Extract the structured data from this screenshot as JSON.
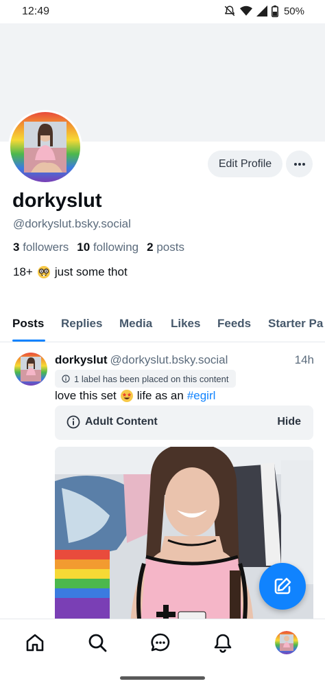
{
  "status_bar": {
    "time": "12:49",
    "battery": "50%",
    "icons": [
      "bell-muted-icon",
      "wifi-icon",
      "signal-icon",
      "battery-icon"
    ]
  },
  "profile": {
    "display_name": "dorkyslut",
    "handle": "@dorkyslut.bsky.social",
    "followers_count": "3",
    "followers_label": "followers",
    "following_count": "10",
    "following_label": "following",
    "posts_count": "2",
    "posts_label": "posts",
    "bio_prefix": "18+",
    "bio_emoji": "nerd-face-emoji",
    "bio_text": "just some thot",
    "edit_button": "Edit Profile",
    "more_button_icon": "ellipsis-icon"
  },
  "tabs": [
    {
      "label": "Posts",
      "active": true
    },
    {
      "label": "Replies",
      "active": false
    },
    {
      "label": "Media",
      "active": false
    },
    {
      "label": "Likes",
      "active": false
    },
    {
      "label": "Feeds",
      "active": false
    },
    {
      "label": "Starter Pa",
      "active": false
    }
  ],
  "post": {
    "author": "dorkyslut",
    "handle": "@dorkyslut.bsky.social",
    "time": "14h",
    "label_notice": "1 label has been placed on this content",
    "text_before": "love this set",
    "text_emoji": "star-struck-emoji",
    "text_middle": "life as an",
    "hashtag": "#egirl",
    "warning_label": "Adult Content",
    "warning_action": "Hide"
  },
  "bottom_nav": [
    "home-icon",
    "search-icon",
    "chat-icon",
    "bell-icon",
    "profile-avatar"
  ],
  "colors": {
    "accent": "#1083fe",
    "muted_text": "#5b6b7c",
    "surface": "#f1f3f5"
  }
}
